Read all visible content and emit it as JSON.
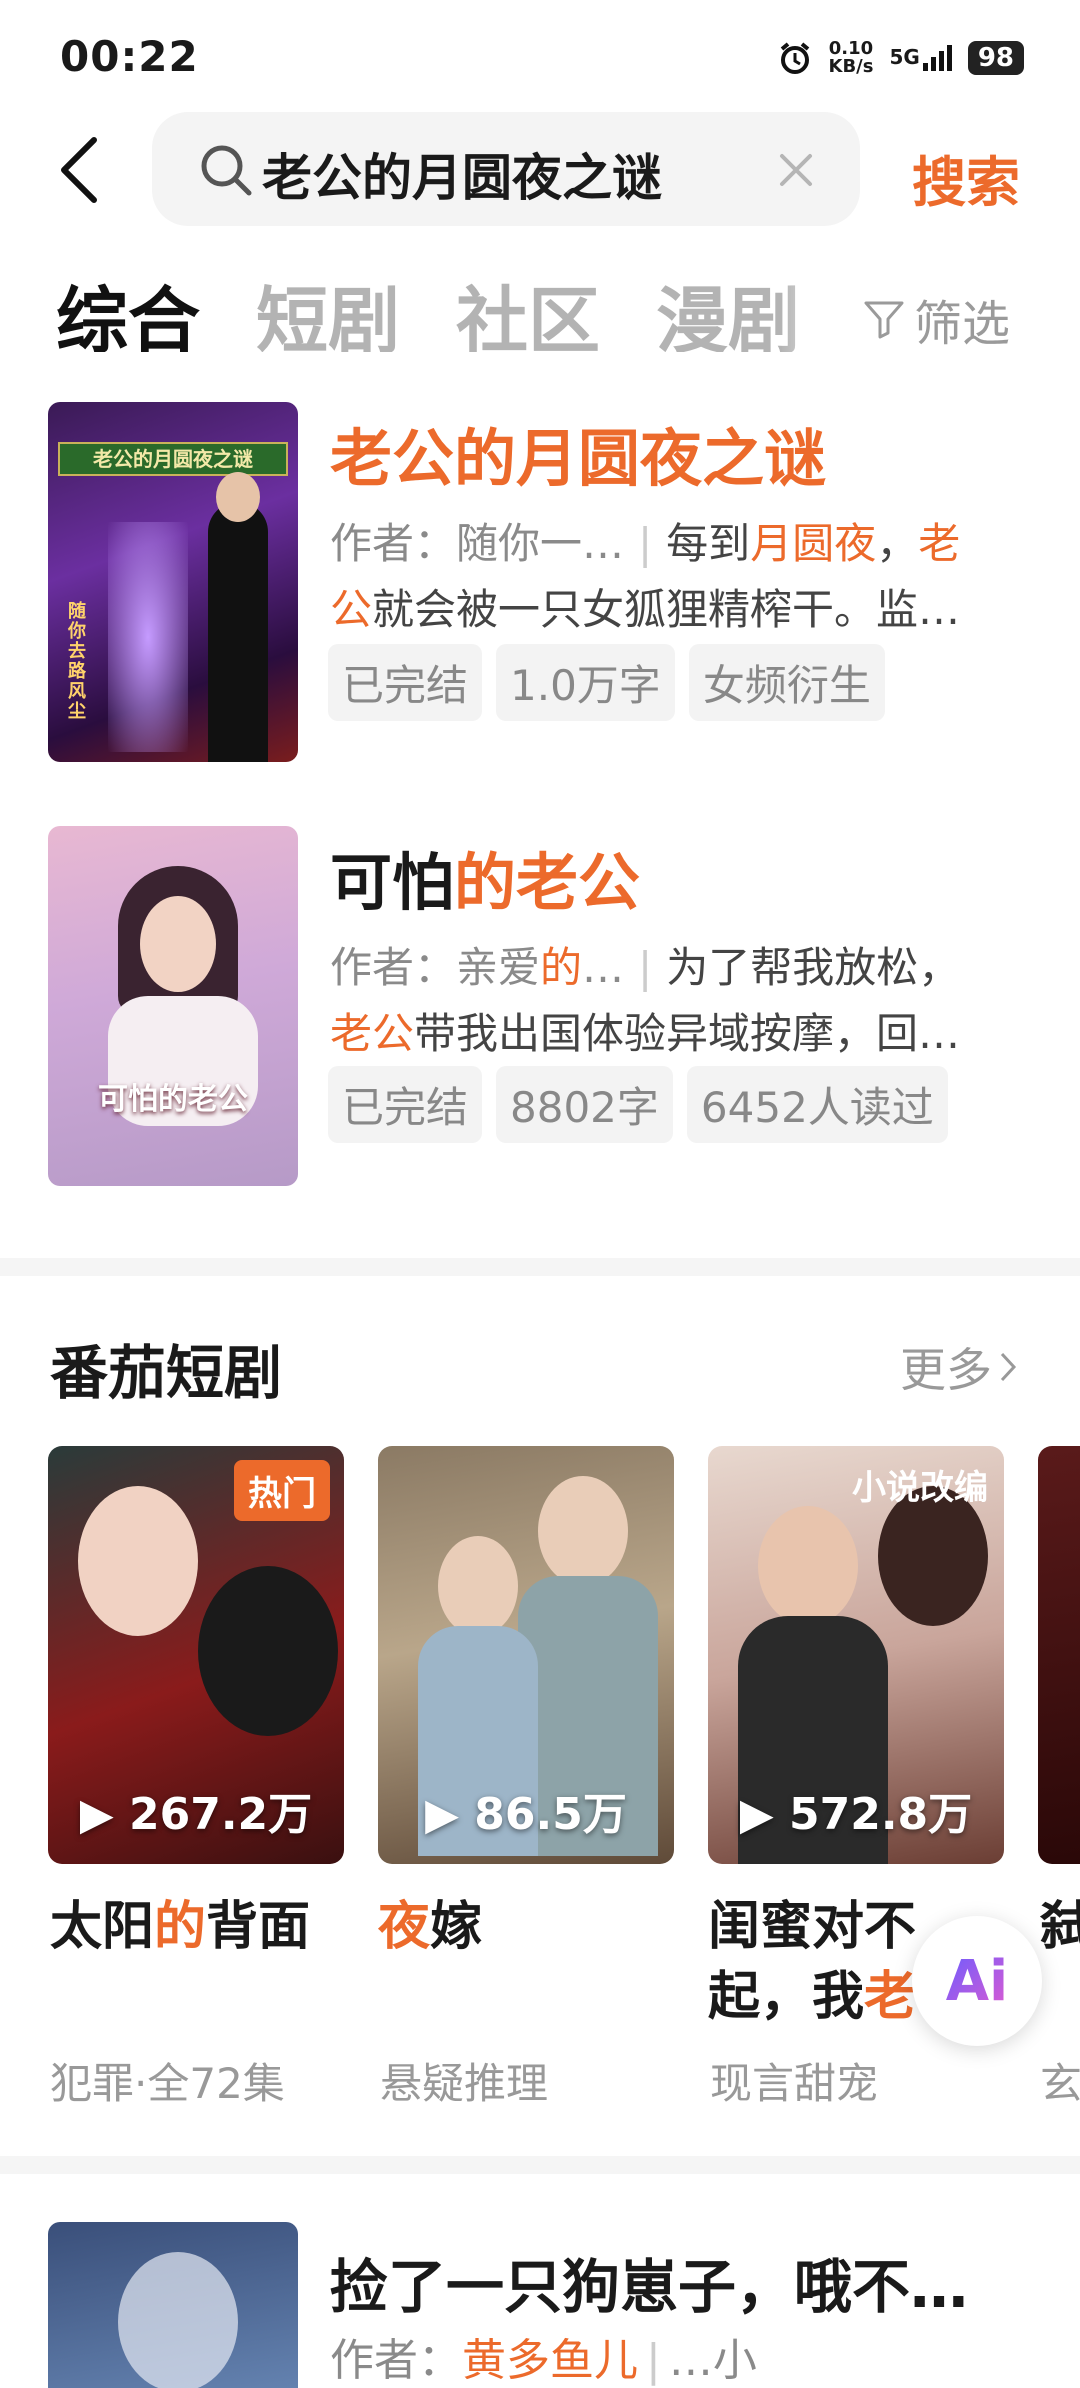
{
  "status_bar": {
    "time": "00:22",
    "speed_value": "0.10",
    "speed_unit": "KB/s",
    "network": "5G",
    "battery": "98"
  },
  "search": {
    "query": "老公的月圆夜之谜",
    "button": "搜索"
  },
  "tabs": [
    {
      "label": "综合"
    },
    {
      "label": "短剧"
    },
    {
      "label": "社区"
    },
    {
      "label": "漫剧"
    }
  ],
  "filter_label": "筛选",
  "books": [
    {
      "cover_text": "老公的月圆夜之谜",
      "cover_author": "随你去路风尘",
      "title": "老公的月圆夜之谜",
      "author": "作者：随你一…",
      "intro_line1_a": "每到",
      "intro_line1_b": "月圆夜",
      "intro_line1_c": "，",
      "intro_line1_d": "老",
      "intro_line2_a": "公",
      "intro_line2_b": "就会被一只女狐狸精榨干。监…",
      "tags": [
        "已完结",
        "1.0万字",
        "女频衍生"
      ]
    },
    {
      "cover_text": "可怕的老公",
      "title_a": "可怕",
      "title_b": "的老公",
      "author_a": "作者：亲爱",
      "author_b": "的",
      "author_c": "…",
      "intro_line1": "为了帮我放松，",
      "intro_line2_a": "老公",
      "intro_line2_b": "带我出国体验异域按摩，回…",
      "tags": [
        "已完结",
        "8802字",
        "6452人读过"
      ]
    }
  ],
  "drama_section": {
    "title": "番茄短剧",
    "more": "更多",
    "items": [
      {
        "badge": "热门",
        "plays": "267.2万",
        "title_a": "太阳",
        "title_b": "的",
        "title_c": "背面",
        "sub": "犯罪·全72集"
      },
      {
        "badge": "",
        "plays": "86.5万",
        "title_a": "",
        "title_b": "夜",
        "title_c": "嫁",
        "sub": "悬疑推理"
      },
      {
        "badge": "小说改编",
        "plays": "572.8万",
        "title_line1": "闺蜜对不",
        "title_line2_a": "起，我",
        "title_line2_b": "老",
        "sub": "现言甜宠"
      },
      {
        "title_partial": "弑",
        "sub": "玄"
      }
    ]
  },
  "ai_button": "Ai",
  "bottom_book": {
    "title": "捡了一只狗崽子，哦不…",
    "author_a": "作者：",
    "author_b": "黄多鱼儿",
    "author_c": "…小"
  },
  "colors": {
    "accent": "#ec6a2b",
    "text": "#1a1a1a",
    "muted": "#8a8a8a"
  }
}
